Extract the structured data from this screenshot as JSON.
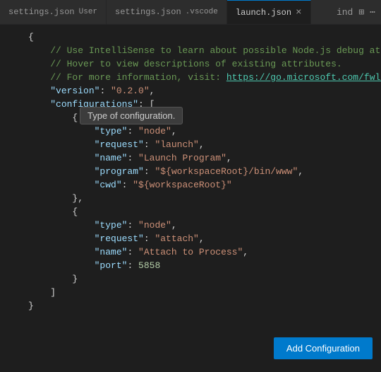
{
  "tabs": [
    {
      "id": "settings-user",
      "label": "settings.json",
      "sublabel": "User",
      "active": false,
      "modified": false
    },
    {
      "id": "settings-vscode",
      "label": "settings.json",
      "sublabel": ".vscode",
      "active": false,
      "modified": false
    },
    {
      "id": "launch-json",
      "label": "launch.json",
      "sublabel": "",
      "active": true,
      "modified": true
    }
  ],
  "tab_icons": [
    "ind",
    "⊞"
  ],
  "tooltip": {
    "text": "Type of configuration."
  },
  "code_lines": [
    {
      "num": "",
      "text": "{"
    },
    {
      "num": "",
      "text": "    // Use IntelliSense to learn about possible Node.js debug attribute"
    },
    {
      "num": "",
      "text": "    // Hover to view descriptions of existing attributes."
    },
    {
      "num": "",
      "text": "    // For more information, visit: https://go.microsoft.com/fwlink/?li"
    },
    {
      "num": "",
      "text": "    \"version\": \"0.2.0\","
    },
    {
      "num": "",
      "text": "    \"configurations\": ["
    },
    {
      "num": "",
      "text": "        {"
    },
    {
      "num": "",
      "text": "            \"type\": \"node\","
    },
    {
      "num": "",
      "text": "            \"request\": \"launch\","
    },
    {
      "num": "",
      "text": "            \"name\": \"Launch Program\","
    },
    {
      "num": "",
      "text": "            \"program\": \"${workspaceRoot}/bin/www\","
    },
    {
      "num": "",
      "text": "            \"cwd\": \"${workspaceRoot}\""
    },
    {
      "num": "",
      "text": "        },"
    },
    {
      "num": "",
      "text": "        {"
    },
    {
      "num": "",
      "text": "            \"type\": \"node\","
    },
    {
      "num": "",
      "text": "            \"request\": \"attach\","
    },
    {
      "num": "",
      "text": "            \"name\": \"Attach to Process\","
    },
    {
      "num": "",
      "text": "            \"port\": 5858"
    },
    {
      "num": "",
      "text": "        }"
    },
    {
      "num": "",
      "text": "    ]"
    },
    {
      "num": "",
      "text": "}"
    }
  ],
  "add_config_button": {
    "label": "Add Configuration"
  }
}
